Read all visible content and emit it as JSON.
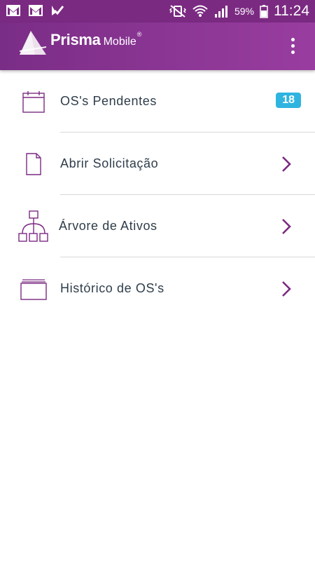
{
  "status_bar": {
    "notification_icons": [
      "gmail-icon",
      "gmail-icon",
      "task-check-icon"
    ],
    "battery_percent": "59%",
    "time": "11:24"
  },
  "app_bar": {
    "logo_brand": "Prisma",
    "logo_product": "Mobile",
    "logo_reg": "®"
  },
  "menu": {
    "items": [
      {
        "label": "OS's Pendentes",
        "icon": "calendar-icon",
        "badge": "18"
      },
      {
        "label": "Abrir Solicitação",
        "icon": "document-icon"
      },
      {
        "label": "Árvore de Ativos",
        "icon": "asset-tree-icon"
      },
      {
        "label": "Histórico de OS's",
        "icon": "folder-history-icon"
      }
    ]
  },
  "colors": {
    "primary": "#7b2a82",
    "accent_badge": "#2fb4e0",
    "chevron": "#7b2a82",
    "text": "#2e3d4a"
  }
}
